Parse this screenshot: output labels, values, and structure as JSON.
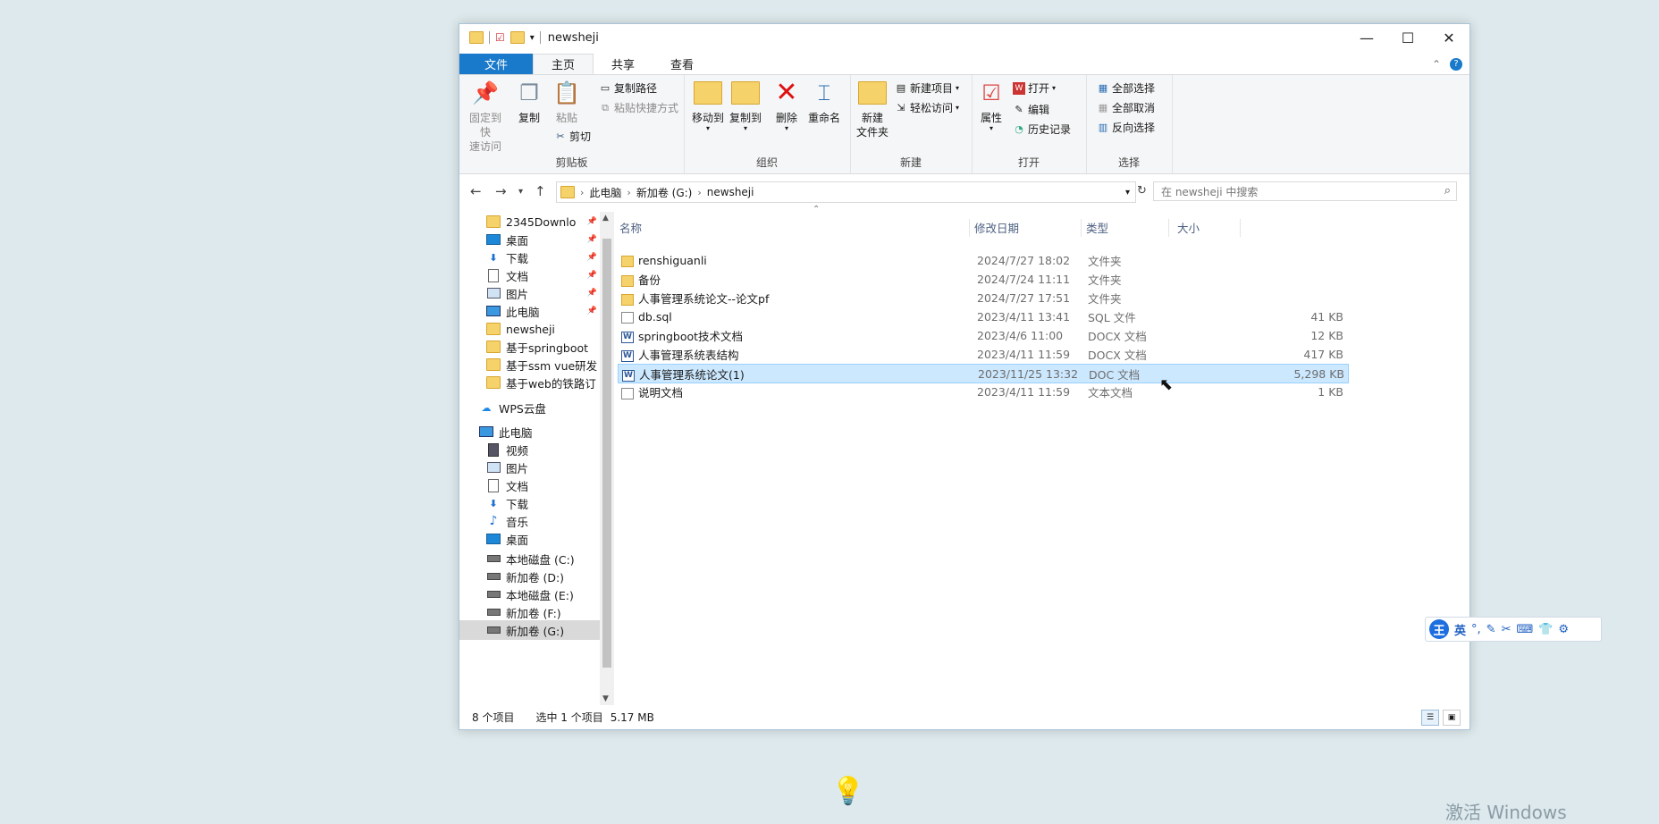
{
  "window": {
    "title": "newsheji"
  },
  "window_controls": {
    "minimize": "—",
    "maximize": "☐",
    "close": "✕"
  },
  "tabs": [
    {
      "label": "文件"
    },
    {
      "label": "主页"
    },
    {
      "label": "共享"
    },
    {
      "label": "查看"
    }
  ],
  "ribbon": {
    "clipboard": {
      "label": "剪贴板",
      "pin": "固定到快\n速访问",
      "copy": "复制",
      "paste": "粘贴",
      "copy_path": "复制路径",
      "paste_shortcut": "粘贴快捷方式",
      "cut": "剪切"
    },
    "organize": {
      "label": "组织",
      "move_to": "移动到",
      "copy_to": "复制到",
      "delete": "删除",
      "rename": "重命名"
    },
    "new": {
      "label": "新建",
      "new_folder": "新建\n文件夹",
      "new_item": "新建项目",
      "easy_access": "轻松访问"
    },
    "open": {
      "label": "打开",
      "properties": "属性",
      "open": "打开",
      "edit": "编辑",
      "history": "历史记录"
    },
    "select": {
      "label": "选择",
      "select_all": "全部选择",
      "select_none": "全部取消",
      "invert": "反向选择"
    }
  },
  "address": {
    "crumbs": [
      "此电脑",
      "新加卷 (G:)",
      "newsheji"
    ],
    "search_placeholder": "在 newsheji 中搜索"
  },
  "nav": {
    "items": [
      {
        "label": "2345Downlo",
        "icon": "folder-icon",
        "pinned": true
      },
      {
        "label": "桌面",
        "icon": "desktop-icon",
        "pinned": true
      },
      {
        "label": "下载",
        "icon": "download-icon",
        "pinned": true
      },
      {
        "label": "文档",
        "icon": "documents-icon",
        "pinned": true
      },
      {
        "label": "图片",
        "icon": "pictures-icon",
        "pinned": true
      },
      {
        "label": "此电脑",
        "icon": "computer-icon",
        "pinned": true
      },
      {
        "label": "newsheji",
        "icon": "folder-icon"
      },
      {
        "label": "基于springboot",
        "icon": "folder-icon"
      },
      {
        "label": "基于ssm vue研发",
        "icon": "folder-icon"
      },
      {
        "label": "基于web的铁路订",
        "icon": "folder-icon"
      },
      {
        "label": "WPS云盘",
        "icon": "cloud-icon"
      },
      {
        "label": "此电脑",
        "icon": "computer-icon"
      },
      {
        "label": "视频",
        "icon": "video-icon"
      },
      {
        "label": "图片",
        "icon": "pictures-icon"
      },
      {
        "label": "文档",
        "icon": "documents-icon"
      },
      {
        "label": "下载",
        "icon": "download-icon"
      },
      {
        "label": "音乐",
        "icon": "music-icon"
      },
      {
        "label": "桌面",
        "icon": "desktop-icon"
      },
      {
        "label": "本地磁盘 (C:)",
        "icon": "drive-icon"
      },
      {
        "label": "新加卷 (D:)",
        "icon": "drive-icon"
      },
      {
        "label": "本地磁盘 (E:)",
        "icon": "drive-icon"
      },
      {
        "label": "新加卷 (F:)",
        "icon": "drive-icon"
      },
      {
        "label": "新加卷 (G:)",
        "icon": "drive-icon",
        "selected": true
      }
    ]
  },
  "columns": {
    "name": "名称",
    "modified": "修改日期",
    "type": "类型",
    "size": "大小"
  },
  "files": [
    {
      "name": "renshiguanli",
      "modified": "2024/7/27 18:02",
      "type": "文件夹",
      "size": "",
      "icon": "folder-icon"
    },
    {
      "name": "备份",
      "modified": "2024/7/24 11:11",
      "type": "文件夹",
      "size": "",
      "icon": "folder-icon"
    },
    {
      "name": "人事管理系统论文--论文pf",
      "modified": "2024/7/27 17:51",
      "type": "文件夹",
      "size": "",
      "icon": "folder-icon"
    },
    {
      "name": "db.sql",
      "modified": "2023/4/11 13:41",
      "type": "SQL 文件",
      "size": "41 KB",
      "icon": "file-icon"
    },
    {
      "name": "springboot技术文档",
      "modified": "2023/4/6 11:00",
      "type": "DOCX 文档",
      "size": "12 KB",
      "icon": "word-doc-icon"
    },
    {
      "name": "人事管理系统表结构",
      "modified": "2023/4/11 11:59",
      "type": "DOCX 文档",
      "size": "417 KB",
      "icon": "word-doc-icon"
    },
    {
      "name": "人事管理系统论文(1)",
      "modified": "2023/11/25 13:32",
      "type": "DOC 文档",
      "size": "5,298 KB",
      "icon": "word-doc-icon",
      "selected": true
    },
    {
      "name": "说明文档",
      "modified": "2023/4/11 11:59",
      "type": "文本文档",
      "size": "1 KB",
      "icon": "text-file-icon"
    }
  ],
  "status": {
    "count": "8 个项目",
    "selected": "选中 1 个项目",
    "size": "5.17 MB"
  },
  "ime": {
    "logo": "王",
    "mode": "英"
  },
  "watermark": "激活 Windows",
  "colors": {
    "accent": "#1979ca",
    "selection": "#cce8ff",
    "folder": "#f6d26a"
  }
}
